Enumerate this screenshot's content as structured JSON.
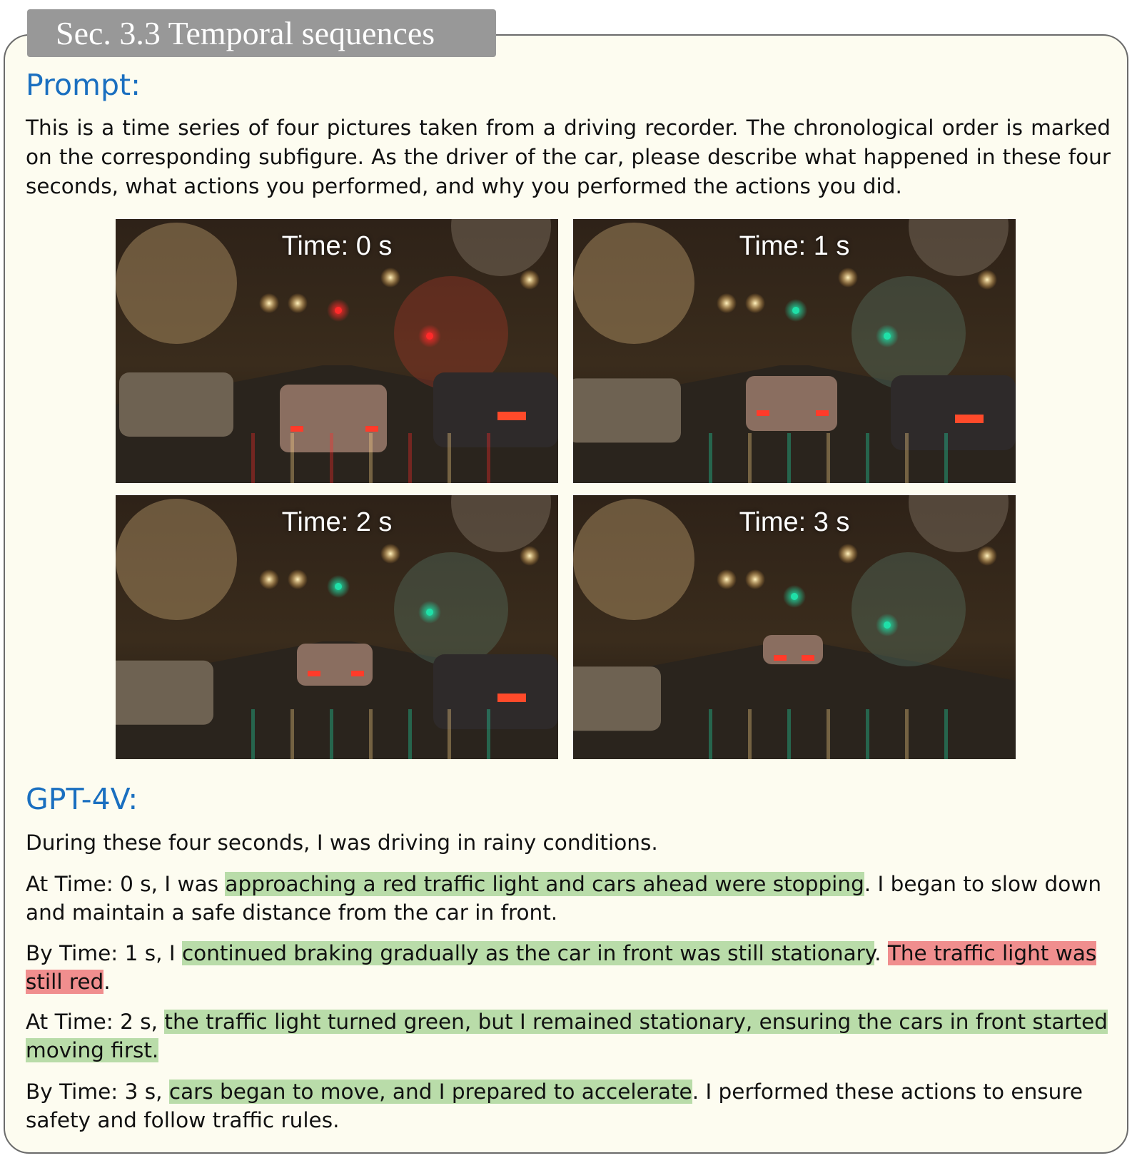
{
  "section_tab": "Sec. 3.3 Temporal sequences",
  "prompt": {
    "heading": "Prompt:",
    "text": "This is a time series of four pictures taken from a driving recorder. The chronological order is marked on the corresponding subfigure. As the driver of the car, please describe what happened in these four seconds, what actions you performed, and why you performed the actions you did."
  },
  "frames": [
    {
      "label": "Time: 0 s",
      "light_color": "#ff2a2a"
    },
    {
      "label": "Time: 1 s",
      "light_color": "#1fe0a8"
    },
    {
      "label": "Time: 2 s",
      "light_color": "#1fe0a8"
    },
    {
      "label": "Time: 3 s",
      "light_color": "#1fe0a8"
    }
  ],
  "response": {
    "heading": "GPT-4V:",
    "paragraphs": [
      {
        "segments": [
          {
            "text": "During these four seconds, I was driving in rainy conditions.",
            "highlight": "none"
          }
        ]
      },
      {
        "segments": [
          {
            "text": "At Time: 0 s, I was ",
            "highlight": "none"
          },
          {
            "text": "approaching a red traffic light and cars ahead were stopping",
            "highlight": "green"
          },
          {
            "text": ". I began to slow down and maintain a safe distance from the car in front.",
            "highlight": "none"
          }
        ]
      },
      {
        "segments": [
          {
            "text": "By Time: 1 s, I ",
            "highlight": "none"
          },
          {
            "text": "continued braking gradually as the car in front was still stationary",
            "highlight": "green"
          },
          {
            "text": ". ",
            "highlight": "none"
          },
          {
            "text": "The traffic light was still red",
            "highlight": "red"
          },
          {
            "text": ".",
            "highlight": "none"
          }
        ]
      },
      {
        "segments": [
          {
            "text": "At Time: 2 s, ",
            "highlight": "none"
          },
          {
            "text": "the traffic light turned green, but I remained stationary, ensuring the cars in front started moving first.",
            "highlight": "green"
          }
        ]
      },
      {
        "segments": [
          {
            "text": "By Time: 3 s, ",
            "highlight": "none"
          },
          {
            "text": "cars began to move, and I prepared to accelerate",
            "highlight": "green"
          },
          {
            "text": ". I performed these actions to ensure safety and follow traffic rules.",
            "highlight": "none"
          }
        ]
      }
    ]
  },
  "colors": {
    "card_background": "#fdfcf0",
    "heading_blue": "#1a6fc0",
    "highlight_green": "#b9dca9",
    "highlight_red": "#f08e8e",
    "tab_gray": "#989898"
  }
}
